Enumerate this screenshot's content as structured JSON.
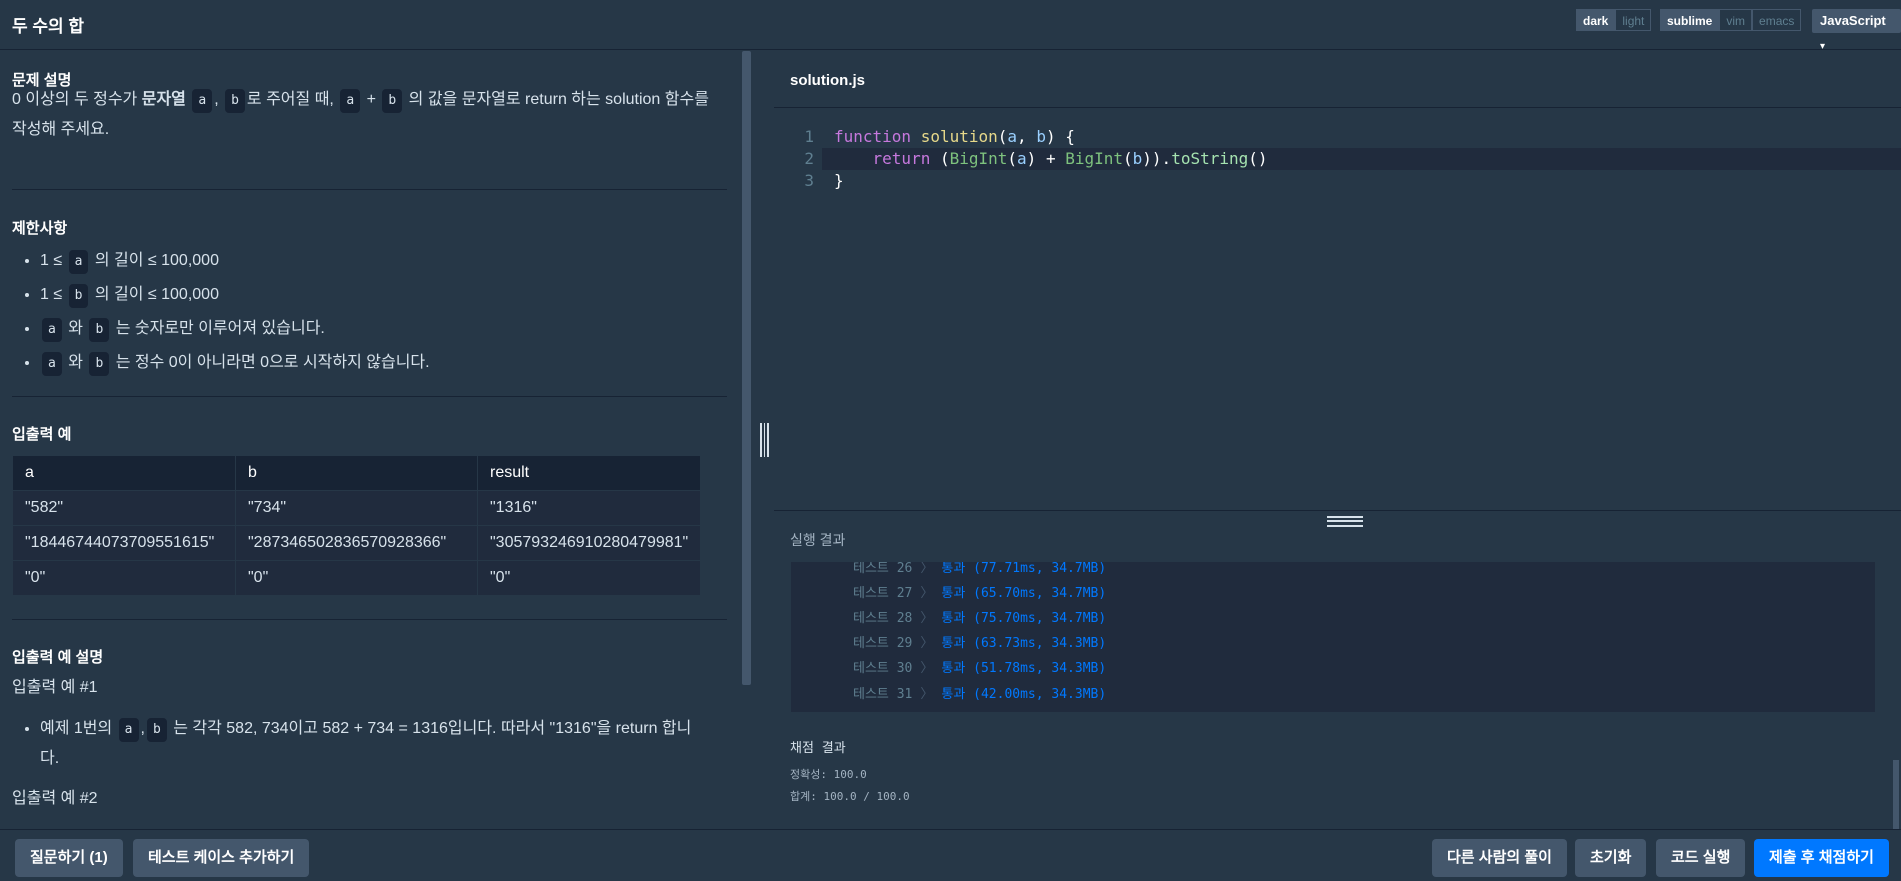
{
  "header": {
    "title": "두 수의 합",
    "theme_options": [
      "dark",
      "light"
    ],
    "theme_selected": "dark",
    "keymap_options": [
      "sublime",
      "vim",
      "emacs"
    ],
    "keymap_selected": "sublime",
    "language": "JavaScript",
    "language_caret": "▾"
  },
  "problem": {
    "desc_heading": "문제 설명",
    "desc_p1_a": "0 이상의 두 정수가 ",
    "desc_p1_bold": "문자열",
    "desc_code_a": "a",
    "desc_comma": ",",
    "desc_code_b": "b",
    "desc_p1_b": "로 주어질 때,",
    "desc_code_a2": "a",
    "desc_plus": "+",
    "desc_code_b2": "b",
    "desc_p1_c": "의 값을 문자열로 return 하는 solution 함수를",
    "desc_p2": "작성해 주세요.",
    "limits_heading": "제한사항",
    "limit1_a": "1 ≤ ",
    "limit1_code": "a",
    "limit1_b": " 의 길이 ≤ 100,000",
    "limit2_a": "1 ≤ ",
    "limit2_code": "b",
    "limit2_b": " 의 길이 ≤ 100,000",
    "limit3_code_a": "a",
    "limit3_mid": " 와 ",
    "limit3_code_b": "b",
    "limit3_end": " 는 숫자로만 이루어져 있습니다.",
    "limit4_code_a": "a",
    "limit4_mid": " 와 ",
    "limit4_code_b": "b",
    "limit4_end": " 는 정수 0이 아니라면 0으로 시작하지 않습니다.",
    "io_heading": "입출력 예",
    "io_table": {
      "headers": [
        "a",
        "b",
        "result"
      ],
      "rows": [
        [
          "\"582\"",
          "\"734\"",
          "\"1316\""
        ],
        [
          "\"18446744073709551615\"",
          "\"287346502836570928366\"",
          "\"305793246910280479981\""
        ],
        [
          "\"0\"",
          "\"0\"",
          "\"0\""
        ]
      ]
    },
    "io_desc_heading": "입출력 예 설명",
    "io_ex1_title": "입출력 예 #1",
    "io_ex1_a": "예제 1번의 ",
    "io_ex1_code_a": "a",
    "io_ex1_comma": ",",
    "io_ex1_code_b": "b",
    "io_ex1_b": " 는 각각 582, 734이고 582 + 734 = 1316입니다. 따라서 \"1316\"을 return 합니",
    "io_ex1_c": "다.",
    "io_ex2_title": "입출력 예 #2"
  },
  "editor": {
    "filename": "solution.js",
    "line_numbers": [
      "1",
      "2",
      "3"
    ],
    "l1_kw": "function",
    "l1_fn": "solution",
    "l1_p1": "(",
    "l1_a": "a",
    "l1_comma": ", ",
    "l1_b": "b",
    "l1_end": ") {",
    "l2_indent": "    ",
    "l2_kw": "return",
    "l2_open": " (",
    "l2_bi1": "BigInt",
    "l2_p1": "(",
    "l2_a": "a",
    "l2_p2": ") + ",
    "l2_bi2": "BigInt",
    "l2_p3": "(",
    "l2_b": "b",
    "l2_p4": ")).",
    "l2_method": "toString",
    "l2_end": "()",
    "l3": "}"
  },
  "results": {
    "title": "실행 결과",
    "tests": [
      {
        "name": "테스트 26",
        "result": "통과 (77.71ms, 34.7MB)"
      },
      {
        "name": "테스트 27",
        "result": "통과 (65.70ms, 34.7MB)"
      },
      {
        "name": "테스트 28",
        "result": "통과 (75.70ms, 34.7MB)"
      },
      {
        "name": "테스트 29",
        "result": "통과 (63.73ms, 34.3MB)"
      },
      {
        "name": "테스트 30",
        "result": "통과 (51.78ms, 34.3MB)"
      },
      {
        "name": "테스트 31",
        "result": "통과 (42.00ms, 34.3MB)"
      }
    ],
    "chevron": "〉",
    "grade_title": "채점 결과",
    "accuracy": "정확성: 100.0",
    "total": "합계: 100.0 / 100.0"
  },
  "footer": {
    "ask": "질문하기 (1)",
    "add_test": "테스트 케이스 추가하기",
    "others": "다른 사람의 풀이",
    "reset": "초기화",
    "run": "코드 실행",
    "submit": "제출 후 채점하기"
  }
}
